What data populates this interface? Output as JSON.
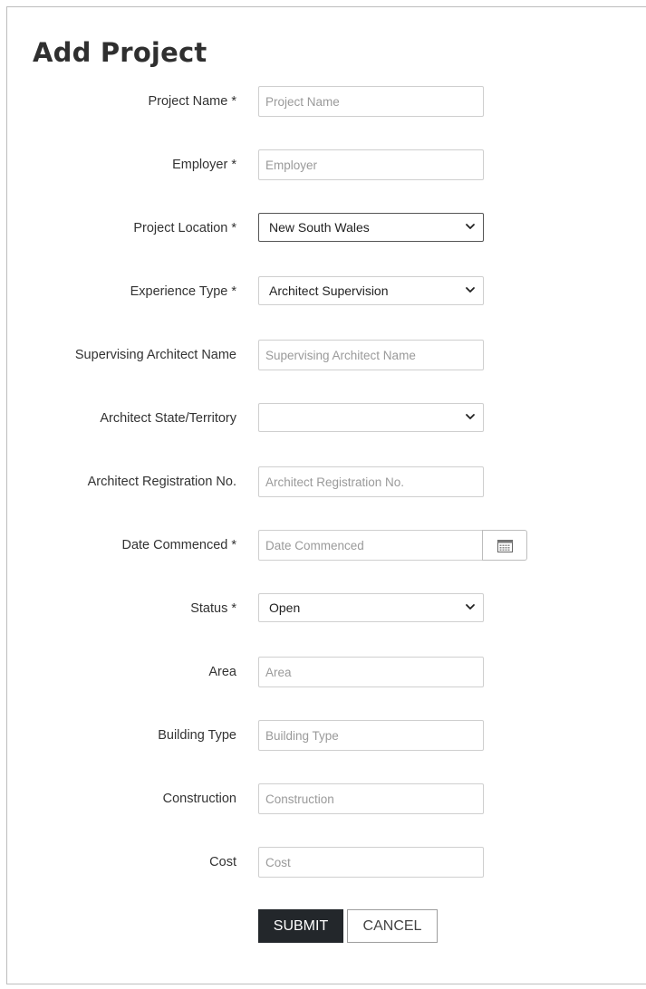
{
  "form": {
    "title": "Add Project",
    "fields": {
      "project_name": {
        "label": "Project Name *",
        "placeholder": "Project Name",
        "value": ""
      },
      "employer": {
        "label": "Employer *",
        "placeholder": "Employer",
        "value": ""
      },
      "project_location": {
        "label": "Project Location *",
        "value": "New South Wales"
      },
      "experience_type": {
        "label": "Experience Type *",
        "value": "Architect Supervision"
      },
      "supervising_architect_name": {
        "label": "Supervising Architect Name",
        "placeholder": "Supervising Architect Name",
        "value": ""
      },
      "architect_state": {
        "label": "Architect State/Territory",
        "value": ""
      },
      "architect_registration": {
        "label": "Architect Registration No.",
        "placeholder": "Architect Registration No.",
        "value": ""
      },
      "date_commenced": {
        "label": "Date Commenced *",
        "placeholder": "Date Commenced",
        "value": "",
        "icon": "calendar-icon"
      },
      "status": {
        "label": "Status *",
        "value": "Open"
      },
      "area": {
        "label": "Area",
        "placeholder": "Area",
        "value": ""
      },
      "building_type": {
        "label": "Building Type",
        "placeholder": "Building Type",
        "value": ""
      },
      "construction": {
        "label": "Construction",
        "placeholder": "Construction",
        "value": ""
      },
      "cost": {
        "label": "Cost",
        "placeholder": "Cost",
        "value": ""
      }
    },
    "actions": {
      "submit_label": "SUBMIT",
      "cancel_label": "CANCEL"
    }
  },
  "colors": {
    "submit_bg": "#23272b",
    "input_border": "#cfcfcf",
    "placeholder": "#9a9a9a"
  }
}
